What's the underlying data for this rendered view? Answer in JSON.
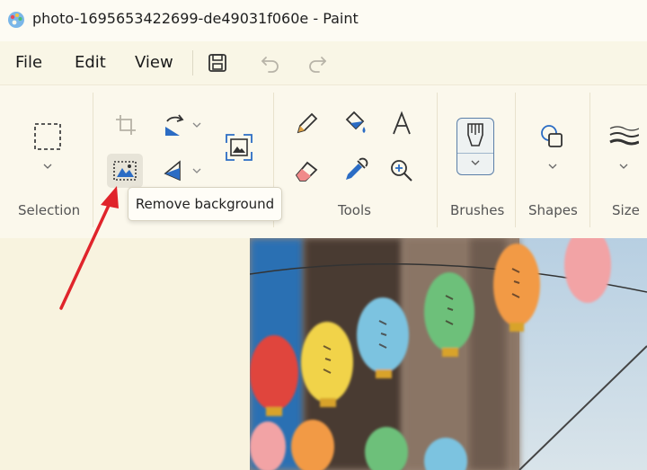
{
  "window": {
    "title": "photo-1695653422699-de49031f060e - Paint"
  },
  "menu": {
    "file": "File",
    "edit": "Edit",
    "view": "View"
  },
  "ribbon": {
    "groups": {
      "selection": "Selection",
      "tools": "Tools",
      "brushes": "Brushes",
      "shapes": "Shapes",
      "size": "Size"
    }
  },
  "tooltip": {
    "text": "Remove background"
  },
  "colors": {
    "accent": "#2b6cc4",
    "arrow": "#e0242b",
    "background": "#fbf8ea"
  }
}
